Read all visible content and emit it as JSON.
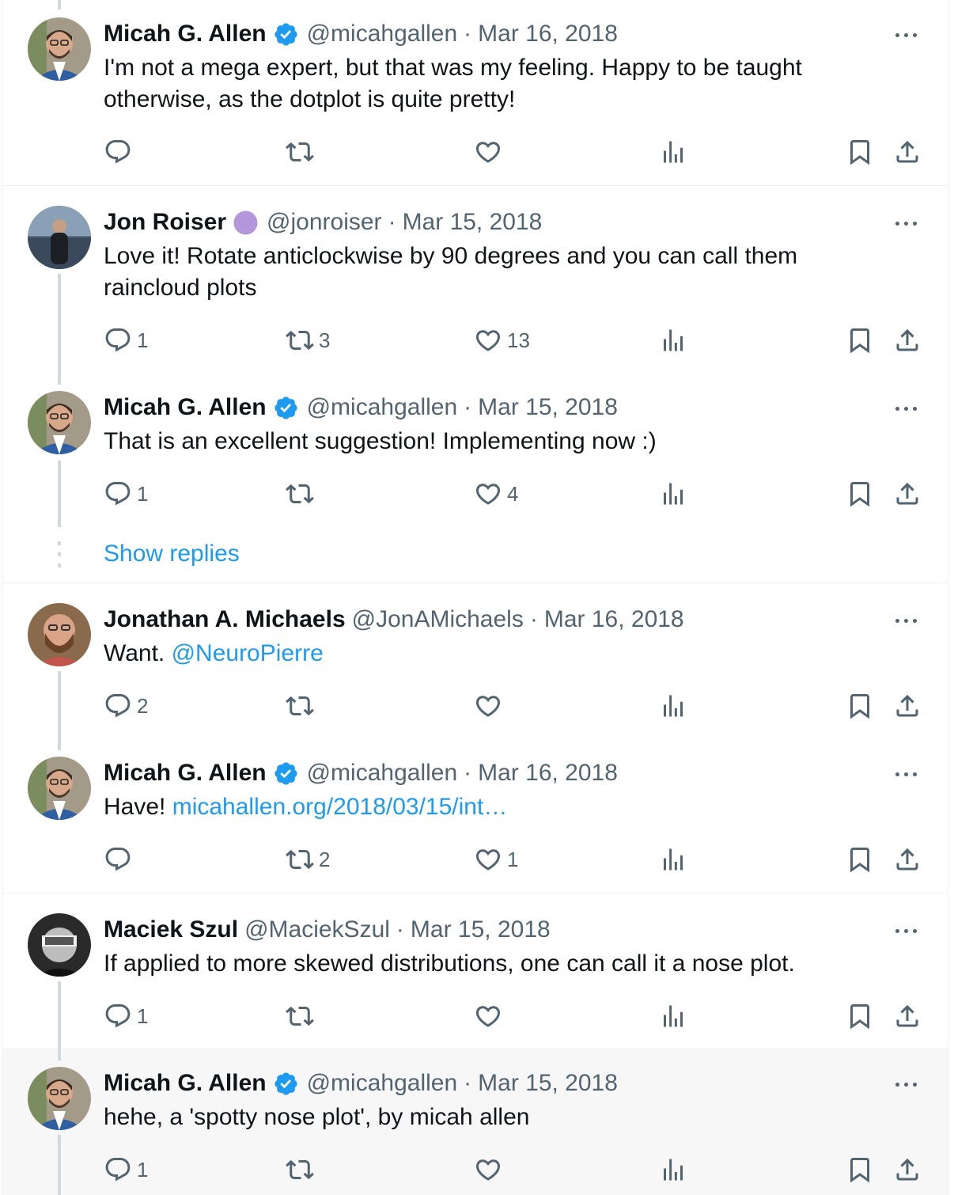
{
  "colors": {
    "link": "#1d9bf0",
    "muted": "#536471",
    "text": "#0f1419",
    "verified": "#1d9bf0",
    "subscriber_badge": "#b396dc"
  },
  "tweets": [
    {
      "name": "Micah G. Allen",
      "badge": "verified",
      "handle": "@micahgallen",
      "sep": "·",
      "date": "Mar 16, 2018",
      "text": "I'm not a mega expert, but that was my feeling. Happy to be taught otherwise, as the dotplot is quite pretty!",
      "reply_count": "",
      "retweet_count": "",
      "like_count": ""
    },
    {
      "name": "Jon Roiser",
      "badge": "purple-dot",
      "handle": "@jonroiser",
      "sep": "·",
      "date": "Mar 15, 2018",
      "text": "Love it! Rotate anticlockwise by 90 degrees and you can call them raincloud plots",
      "reply_count": "1",
      "retweet_count": "3",
      "like_count": "13"
    },
    {
      "name": "Micah G. Allen",
      "badge": "verified",
      "handle": "@micahgallen",
      "sep": "·",
      "date": "Mar 15, 2018",
      "text": "That is an excellent suggestion! Implementing now :)",
      "reply_count": "1",
      "retweet_count": "",
      "like_count": "4"
    },
    {
      "name": "Jonathan A. Michaels",
      "badge": "none",
      "handle": "@JonAMichaels",
      "sep": "·",
      "date": "Mar 16, 2018",
      "text_prefix": "Want. ",
      "mention": "@NeuroPierre",
      "reply_count": "2",
      "retweet_count": "",
      "like_count": ""
    },
    {
      "name": "Micah G. Allen",
      "badge": "verified",
      "handle": "@micahgallen",
      "sep": "·",
      "date": "Mar 16, 2018",
      "text_prefix": "Have! ",
      "url": "micahallen.org/2018/03/15/int…",
      "reply_count": "",
      "retweet_count": "2",
      "like_count": "1"
    },
    {
      "name": "Maciek Szul",
      "badge": "none",
      "handle": "@MaciekSzul",
      "sep": "·",
      "date": "Mar 15, 2018",
      "text": "If applied to more skewed distributions, one can call it a nose plot.",
      "reply_count": "1",
      "retweet_count": "",
      "like_count": ""
    },
    {
      "name": "Micah G. Allen",
      "badge": "verified",
      "handle": "@micahgallen",
      "sep": "·",
      "date": "Mar 15, 2018",
      "text": "hehe, a 'spotty nose plot', by micah allen",
      "reply_count": "1",
      "retweet_count": "",
      "like_count": ""
    }
  ],
  "show_replies": "Show replies",
  "icons": {
    "reply": "reply-icon",
    "retweet": "retweet-icon",
    "like": "heart-icon",
    "views": "views-icon",
    "bookmark": "bookmark-icon",
    "share": "share-icon",
    "more": "more-icon",
    "verified": "verified-badge-icon"
  }
}
